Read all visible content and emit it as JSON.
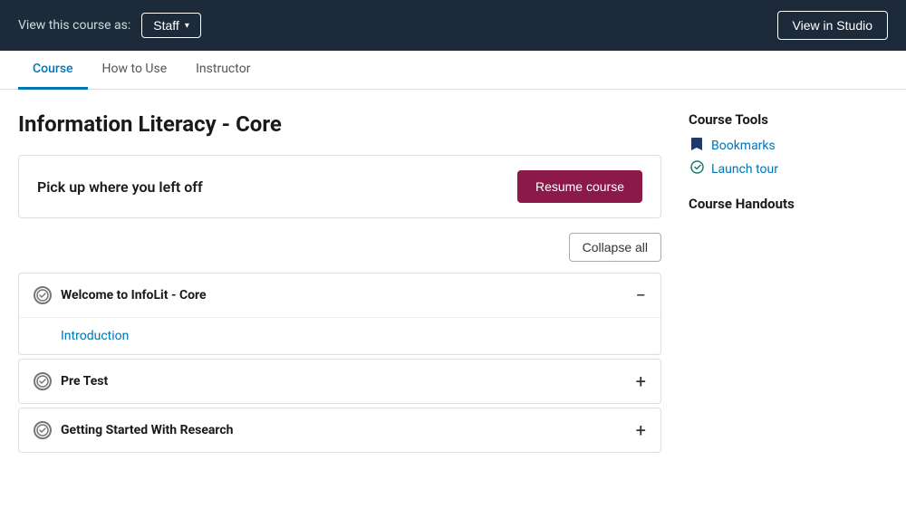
{
  "topbar": {
    "view_as_label": "View this course as:",
    "staff_label": "Staff",
    "view_in_studio_label": "View in Studio"
  },
  "nav_tabs": [
    {
      "id": "course",
      "label": "Course",
      "active": true
    },
    {
      "id": "how-to-use",
      "label": "How to Use",
      "active": false
    },
    {
      "id": "instructor",
      "label": "Instructor",
      "active": false
    }
  ],
  "course": {
    "title": "Information Literacy - Core"
  },
  "resume_card": {
    "text": "Pick up where you left off",
    "button_label": "Resume course"
  },
  "collapse_button": {
    "label": "Collapse all"
  },
  "sections": [
    {
      "id": "welcome",
      "title": "Welcome to InfoLit - Core",
      "expanded": true,
      "subsections": [
        {
          "id": "intro",
          "label": "Introduction"
        }
      ]
    },
    {
      "id": "pre-test",
      "title": "Pre Test",
      "expanded": false,
      "subsections": []
    },
    {
      "id": "getting-started",
      "title": "Getting Started With Research",
      "expanded": false,
      "subsections": []
    }
  ],
  "course_tools": {
    "title": "Course Tools",
    "items": [
      {
        "id": "bookmarks",
        "label": "Bookmarks",
        "icon": "bookmark"
      },
      {
        "id": "launch-tour",
        "label": "Launch tour",
        "icon": "check-circle"
      }
    ]
  },
  "course_handouts": {
    "title": "Course Handouts"
  },
  "icons": {
    "chevron_down": "▾",
    "minus": "−",
    "plus": "+"
  }
}
